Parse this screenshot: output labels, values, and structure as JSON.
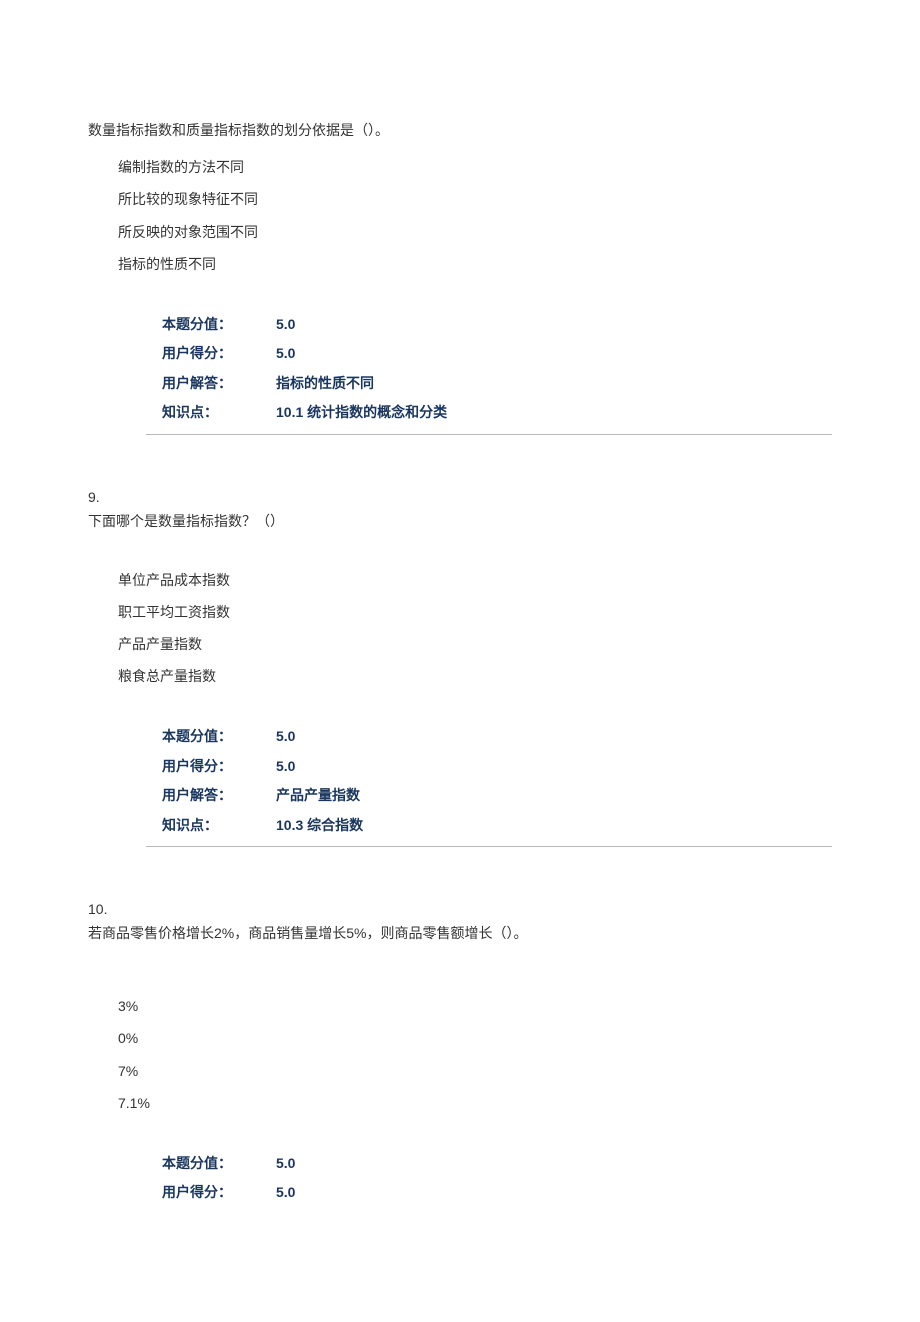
{
  "colors": {
    "bold": "#1a365f"
  },
  "questions": [
    {
      "number": "",
      "stem": "数量指标指数和质量指标指数的划分依据是（）。",
      "extra": "",
      "options": [
        "编制指数的方法不同",
        "所比较的现象特征不同",
        "所反映的对象范围不同",
        "指标的性质不同"
      ],
      "info": {
        "score_label": "本题分值：",
        "score_value": "5.0",
        "user_score_label": "用户得分：",
        "user_score_value": "5.0",
        "answer_label": "用户解答：",
        "answer_value": "指标的性质不同",
        "kp_label": "知识点：",
        "kp_value": "10.1  统计指数的概念和分类"
      },
      "show_divider": true
    },
    {
      "number": "9.",
      "stem": "下面哪个是数量指标指数？（）",
      "extra": "",
      "options": [
        "单位产品成本指数",
        "职工平均工资指数",
        "产品产量指数",
        "粮食总产量指数"
      ],
      "info": {
        "score_label": "本题分值：",
        "score_value": "5.0",
        "user_score_label": "用户得分：",
        "user_score_value": "5.0",
        "answer_label": "用户解答：",
        "answer_value": "产品产量指数",
        "kp_label": "知识点：",
        "kp_value": "10.3  综合指数"
      },
      "show_divider": true
    },
    {
      "number": "10.",
      "stem": "若商品零售价格增长2%，商品销售量增长5%，则商品零售额增长（）。",
      "extra": "",
      "options": [
        "3%",
        "0%",
        "7%",
        "7.1%"
      ],
      "info": {
        "score_label": "本题分值：",
        "score_value": "5.0",
        "user_score_label": "用户得分：",
        "user_score_value": "5.0",
        "answer_label": "",
        "answer_value": "",
        "kp_label": "",
        "kp_value": ""
      },
      "show_divider": false
    }
  ]
}
